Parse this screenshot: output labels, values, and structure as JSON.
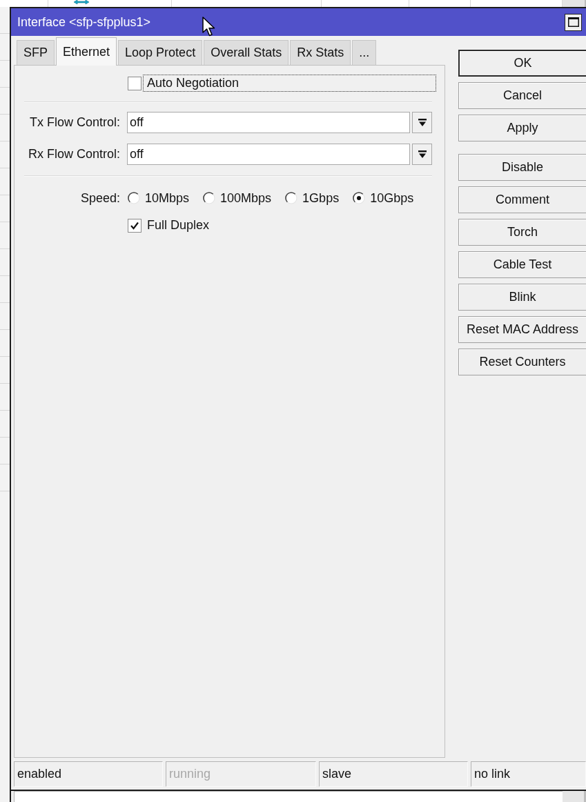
{
  "window": {
    "title": "Interface <sfp-sfpplus1>"
  },
  "tabs": [
    {
      "label": "SFP",
      "selected": false
    },
    {
      "label": "Ethernet",
      "selected": true
    },
    {
      "label": "Loop Protect",
      "selected": false
    },
    {
      "label": "Overall Stats",
      "selected": false
    },
    {
      "label": "Rx Stats",
      "selected": false
    },
    {
      "label": "...",
      "selected": false
    }
  ],
  "ethernet": {
    "auto_negotiation": {
      "label": "Auto Negotiation",
      "checked": false,
      "focused": true
    },
    "flow_control": [
      {
        "label": "Tx Flow Control:",
        "value": "off"
      },
      {
        "label": "Rx Flow Control:",
        "value": "off"
      }
    ],
    "speed": {
      "label": "Speed:",
      "options": [
        {
          "label": "10Mbps",
          "selected": false
        },
        {
          "label": "100Mbps",
          "selected": false
        },
        {
          "label": "1Gbps",
          "selected": false
        },
        {
          "label": "10Gbps",
          "selected": true
        }
      ]
    },
    "full_duplex": {
      "label": "Full Duplex",
      "checked": true
    }
  },
  "button_groups": [
    [
      {
        "label": "OK",
        "default": true
      },
      {
        "label": "Cancel",
        "default": false
      },
      {
        "label": "Apply",
        "default": false
      }
    ],
    [
      {
        "label": "Disable",
        "default": false
      },
      {
        "label": "Comment",
        "default": false
      },
      {
        "label": "Torch",
        "default": false
      },
      {
        "label": "Cable Test",
        "default": false
      },
      {
        "label": "Blink",
        "default": false
      },
      {
        "label": "Reset MAC Address",
        "default": false
      },
      {
        "label": "Reset Counters",
        "default": false
      }
    ]
  ],
  "status_bar": [
    {
      "text": "enabled",
      "disabled": false
    },
    {
      "text": "running",
      "disabled": true
    },
    {
      "text": "slave",
      "disabled": false
    },
    {
      "text": "no link",
      "disabled": false
    }
  ]
}
